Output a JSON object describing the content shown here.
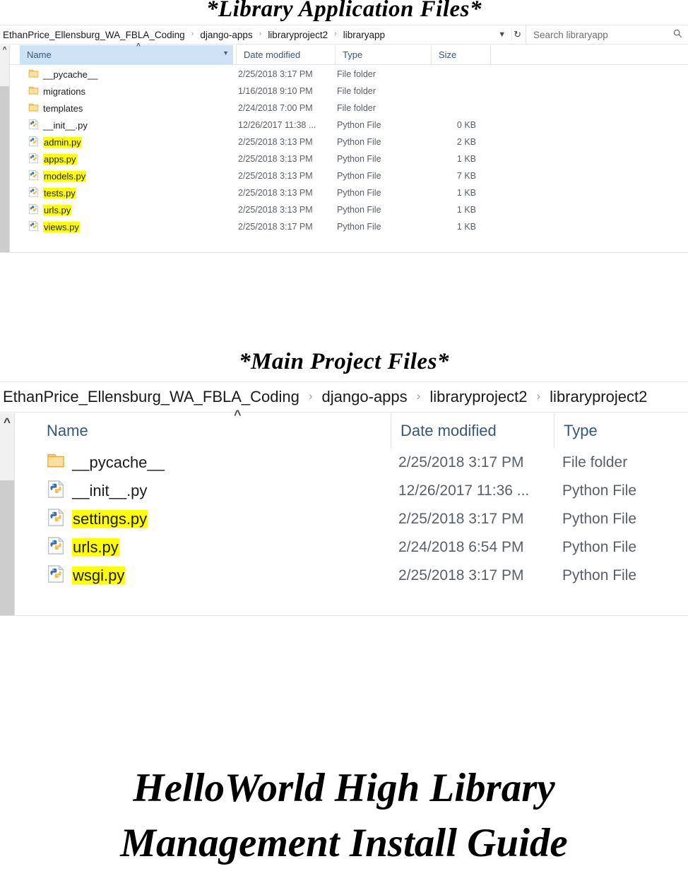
{
  "document": {
    "heading_library": "*Library Application Files*",
    "heading_main": "*Main Project Files*",
    "title_line1": "HelloWorld High Library",
    "title_line2": "Management Install Guide"
  },
  "colors": {
    "highlight": "#ffff00",
    "column_sorted": "#cde3f5",
    "header_text": "#36577a",
    "row_text": "#5a5f66",
    "scrollbar_thumb": "#cdcdcd"
  },
  "windows": [
    {
      "id": "library-app-explorer",
      "breadcrumb": {
        "items": [
          "EthanPrice_Ellensburg_WA_FBLA_Coding",
          "django-apps",
          "libraryproject2",
          "libraryapp"
        ],
        "separator": "›",
        "dropdown_icon": "chevron-down-icon",
        "refresh_icon": "refresh-icon"
      },
      "search": {
        "placeholder": "Search libraryapp",
        "value": "",
        "icon": "search-icon"
      },
      "columns": [
        {
          "label": "Name",
          "sorted": true,
          "sort_direction": "ascending"
        },
        {
          "label": "Date modified",
          "sorted": false
        },
        {
          "label": "Type",
          "sorted": false
        },
        {
          "label": "Size",
          "sorted": false
        }
      ],
      "rows": [
        {
          "icon": "folder-icon",
          "name": "__pycache__",
          "highlighted": false,
          "date": "2/25/2018 3:17 PM",
          "type": "File folder",
          "size": ""
        },
        {
          "icon": "folder-icon",
          "name": "migrations",
          "highlighted": false,
          "date": "1/16/2018 9:10 PM",
          "type": "File folder",
          "size": ""
        },
        {
          "icon": "folder-icon",
          "name": "templates",
          "highlighted": false,
          "date": "2/24/2018 7:00 PM",
          "type": "File folder",
          "size": ""
        },
        {
          "icon": "python-file-icon",
          "name": "__init__.py",
          "highlighted": false,
          "date": "12/26/2017 11:38 ...",
          "type": "Python File",
          "size": "0 KB"
        },
        {
          "icon": "python-file-icon",
          "name": "admin.py",
          "highlighted": true,
          "date": "2/25/2018 3:13 PM",
          "type": "Python File",
          "size": "2 KB"
        },
        {
          "icon": "python-file-icon",
          "name": "apps.py",
          "highlighted": true,
          "date": "2/25/2018 3:13 PM",
          "type": "Python File",
          "size": "1 KB"
        },
        {
          "icon": "python-file-icon",
          "name": "models.py",
          "highlighted": true,
          "date": "2/25/2018 3:13 PM",
          "type": "Python File",
          "size": "7 KB"
        },
        {
          "icon": "python-file-icon",
          "name": "tests.py",
          "highlighted": true,
          "date": "2/25/2018 3:13 PM",
          "type": "Python File",
          "size": "1 KB"
        },
        {
          "icon": "python-file-icon",
          "name": "urls.py",
          "highlighted": true,
          "date": "2/25/2018 3:13 PM",
          "type": "Python File",
          "size": "1 KB"
        },
        {
          "icon": "python-file-icon",
          "name": "views.py",
          "highlighted": true,
          "date": "2/25/2018 3:17 PM",
          "type": "Python File",
          "size": "1 KB"
        }
      ]
    },
    {
      "id": "main-project-explorer",
      "breadcrumb": {
        "items": [
          "EthanPrice_Ellensburg_WA_FBLA_Coding",
          "django-apps",
          "libraryproject2",
          "libraryproject2"
        ],
        "separator": "›"
      },
      "columns": [
        {
          "label": "Name",
          "sorted": false,
          "sort_direction": "ascending"
        },
        {
          "label": "Date modified",
          "sorted": false
        },
        {
          "label": "Type",
          "sorted": false
        }
      ],
      "rows": [
        {
          "icon": "folder-icon",
          "name": "__pycache__",
          "highlighted": false,
          "date": "2/25/2018 3:17 PM",
          "type": "File folder"
        },
        {
          "icon": "python-file-icon",
          "name": "__init__.py",
          "highlighted": false,
          "date": "12/26/2017 11:36 ...",
          "type": "Python File"
        },
        {
          "icon": "python-file-icon",
          "name": "settings.py",
          "highlighted": true,
          "date": "2/25/2018 3:17 PM",
          "type": "Python File"
        },
        {
          "icon": "python-file-icon",
          "name": "urls.py",
          "highlighted": true,
          "date": "2/24/2018 6:54 PM",
          "type": "Python File"
        },
        {
          "icon": "python-file-icon",
          "name": "wsgi.py",
          "highlighted": true,
          "date": "2/25/2018 3:17 PM",
          "type": "Python File"
        }
      ]
    }
  ]
}
